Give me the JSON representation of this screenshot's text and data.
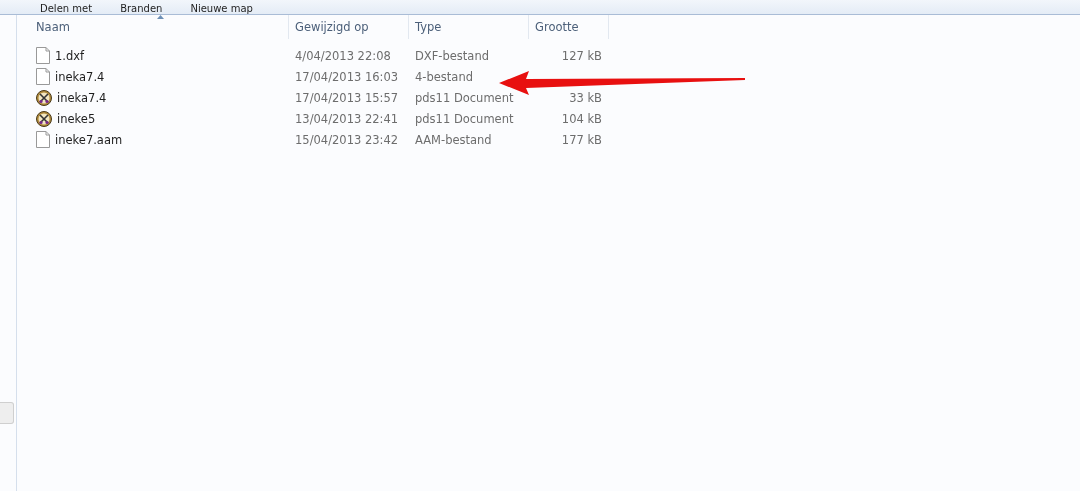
{
  "toolbar": {
    "items": [
      "Delen met",
      "Branden",
      "Nieuwe map"
    ]
  },
  "table": {
    "columns": [
      {
        "label": "Naam",
        "sorted": true
      },
      {
        "label": "Gewijzigd op",
        "sorted": false
      },
      {
        "label": "Type",
        "sorted": false
      },
      {
        "label": "Grootte",
        "sorted": false
      }
    ],
    "rows": [
      {
        "name": "1.dxf",
        "kind": "blank",
        "modified": "4/04/2013 22:08",
        "type": "DXF-bestand",
        "size": "127 kB"
      },
      {
        "name": "ineka7.4",
        "kind": "blank",
        "modified": "17/04/2013 16:03",
        "type": "4-bestand"
      },
      {
        "name": "ineka7.4",
        "kind": "pds",
        "modified": "17/04/2013 15:57",
        "type": "pds11 Document",
        "size": "33 kB"
      },
      {
        "name": "ineke5",
        "kind": "pds",
        "modified": "13/04/2013 22:41",
        "type": "pds11 Document",
        "size": "104 kB"
      },
      {
        "name": "ineke7.aam",
        "kind": "blank",
        "modified": "15/04/2013 23:42",
        "type": "AAM-bestand",
        "size": "177 kB"
      }
    ]
  }
}
